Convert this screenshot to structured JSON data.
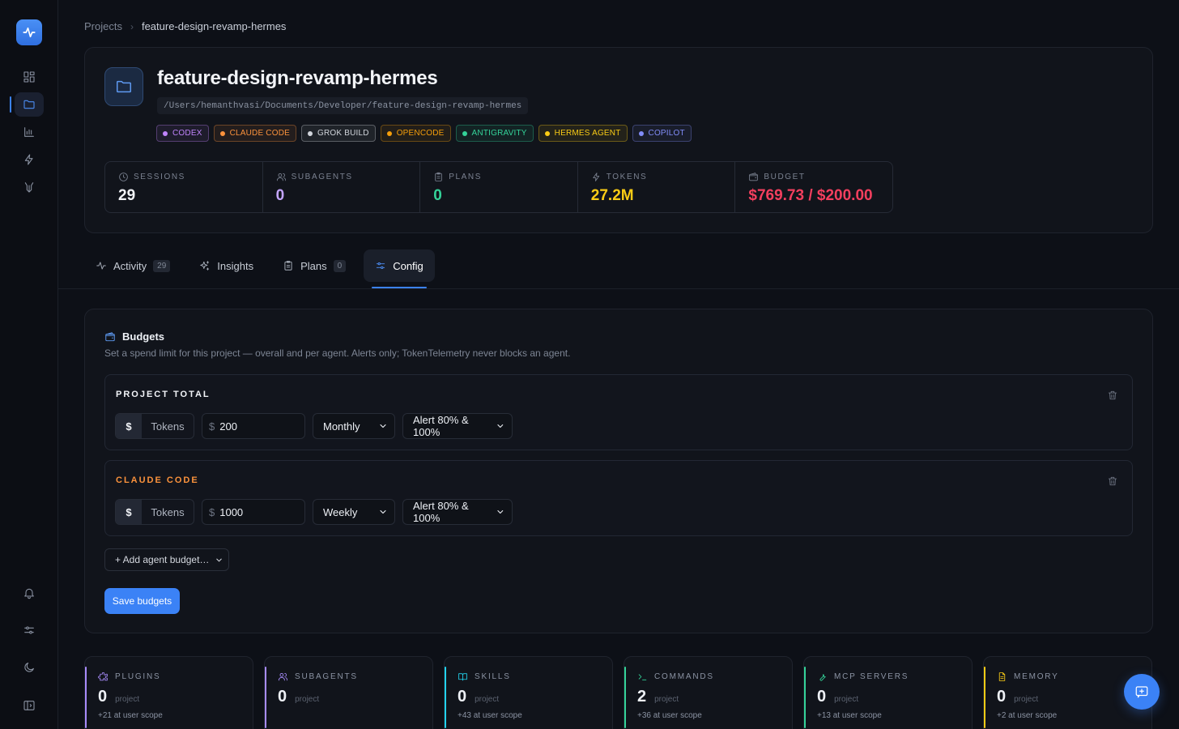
{
  "sidebar": {
    "nav": [
      "Dashboard",
      "Projects",
      "Analytics",
      "Activity",
      "Agents"
    ],
    "bottom": [
      "Notifications",
      "Settings",
      "Theme",
      "Collapse sidebar"
    ]
  },
  "breadcrumb": {
    "root": "Projects",
    "current": "feature-design-revamp-hermes"
  },
  "project": {
    "title": "feature-design-revamp-hermes",
    "path": "/Users/hemanthvasi/Documents/Developer/feature-design-revamp-hermes",
    "agents": [
      {
        "label": "CODEX",
        "color": "#c084fc"
      },
      {
        "label": "CLAUDE CODE",
        "color": "#fb923c"
      },
      {
        "label": "GROK BUILD",
        "color": "#d1d5db"
      },
      {
        "label": "OPENCODE",
        "color": "#f59e0b"
      },
      {
        "label": "ANTIGRAVITY",
        "color": "#34d399"
      },
      {
        "label": "HERMES AGENT",
        "color": "#facc15"
      },
      {
        "label": "COPILOT",
        "color": "#818cf8"
      }
    ]
  },
  "stats": {
    "sessions": {
      "label": "SESSIONS",
      "value": "29",
      "color": "#f2f4f8"
    },
    "subagents": {
      "label": "SUBAGENTS",
      "value": "0",
      "color": "#c4a5ff"
    },
    "plans": {
      "label": "PLANS",
      "value": "0",
      "color": "#34d399"
    },
    "tokens": {
      "label": "TOKENS",
      "value": "27.2M",
      "color": "#facc15"
    },
    "budget": {
      "label": "BUDGET",
      "value": "$769.73 / $200.00",
      "color": "#f43f5e"
    }
  },
  "tabs": {
    "activity": {
      "label": "Activity",
      "count": "29"
    },
    "insights": {
      "label": "Insights"
    },
    "plans": {
      "label": "Plans",
      "count": "0"
    },
    "config": {
      "label": "Config"
    }
  },
  "budgets": {
    "title": "Budgets",
    "description": "Set a spend limit for this project — overall and per agent. Alerts only; TokenTelemetry never blocks an agent.",
    "rows": [
      {
        "label": "PROJECT TOTAL",
        "label_color": "#f2f4f8",
        "unit_on": "$",
        "unit_off": "Tokens",
        "currency": "$",
        "amount": "200",
        "period": "Monthly",
        "alert": "Alert 80% & 100%"
      },
      {
        "label": "CLAUDE CODE",
        "label_color": "#fb923c",
        "unit_on": "$",
        "unit_off": "Tokens",
        "currency": "$",
        "amount": "1000",
        "period": "Weekly",
        "alert": "Alert 80% & 100%"
      }
    ],
    "add_agent": "+ Add agent budget…",
    "save": "Save budgets"
  },
  "scopes": [
    {
      "label": "PLUGINS",
      "value": "0",
      "sub": "project",
      "user": "+21 at user scope",
      "color": "#a78bfa",
      "icon": "puzzle-icon"
    },
    {
      "label": "SUBAGENTS",
      "value": "0",
      "sub": "project",
      "user": "",
      "color": "#a78bfa",
      "icon": "users-icon"
    },
    {
      "label": "SKILLS",
      "value": "0",
      "sub": "project",
      "user": "+43 at user scope",
      "color": "#22d3ee",
      "icon": "book-icon"
    },
    {
      "label": "COMMANDS",
      "value": "2",
      "sub": "project",
      "user": "+36 at user scope",
      "color": "#34d399",
      "icon": "terminal-icon"
    },
    {
      "label": "MCP SERVERS",
      "value": "0",
      "sub": "project",
      "user": "+13 at user scope",
      "color": "#34d399",
      "icon": "wrench-icon"
    },
    {
      "label": "MEMORY",
      "value": "0",
      "sub": "project",
      "user": "+2 at user scope",
      "color": "#facc15",
      "icon": "file-icon"
    }
  ]
}
